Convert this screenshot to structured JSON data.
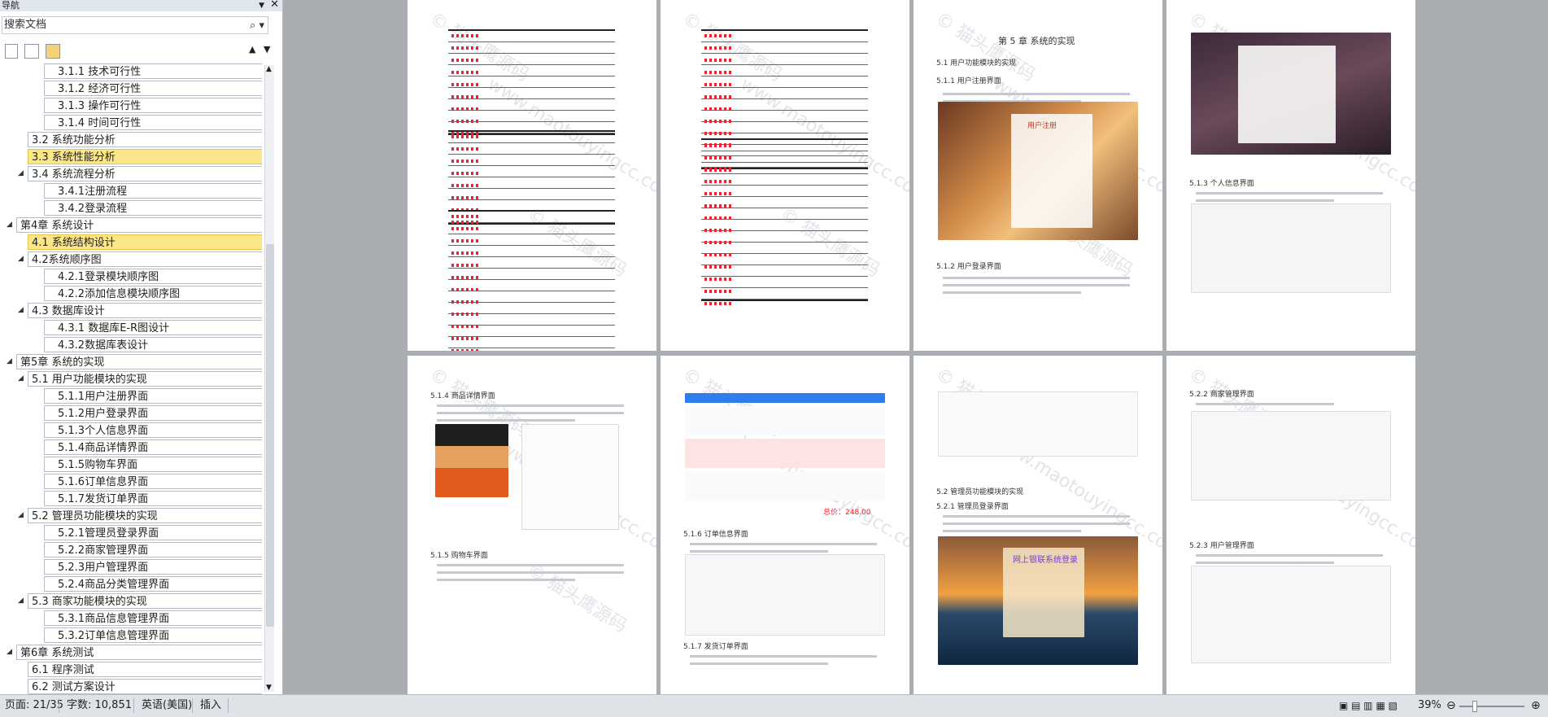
{
  "nav": {
    "title": "导航",
    "search_placeholder": "搜索文档",
    "items": [
      {
        "label": "3.1.1 技术可行性",
        "level": 2
      },
      {
        "label": "3.1.2 经济可行性",
        "level": 2
      },
      {
        "label": "3.1.3 操作可行性",
        "level": 2
      },
      {
        "label": "3.1.4 时间可行性",
        "level": 2
      },
      {
        "label": "3.2 系统功能分析",
        "level": 1
      },
      {
        "label": "3.3 系统性能分析",
        "level": 1,
        "selected": true
      },
      {
        "label": "3.4 系统流程分析",
        "level": 1,
        "toggle": true
      },
      {
        "label": "3.4.1注册流程",
        "level": 2
      },
      {
        "label": "3.4.2登录流程",
        "level": 2
      },
      {
        "label": "第4章  系统设计",
        "level": 0,
        "toggle": true
      },
      {
        "label": "4.1 系统结构设计",
        "level": 1,
        "selected": true
      },
      {
        "label": "4.2系统顺序图",
        "level": 1,
        "toggle": true
      },
      {
        "label": "4.2.1登录模块顺序图",
        "level": 2
      },
      {
        "label": "4.2.2添加信息模块顺序图",
        "level": 2
      },
      {
        "label": "4.3 数据库设计",
        "level": 1,
        "toggle": true
      },
      {
        "label": "4.3.1  数据库E-R图设计",
        "level": 2
      },
      {
        "label": "4.3.2数据库表设计",
        "level": 2
      },
      {
        "label": "第5章  系统的实现",
        "level": 0,
        "toggle": true
      },
      {
        "label": "5.1 用户功能模块的实现",
        "level": 1,
        "toggle": true
      },
      {
        "label": "5.1.1用户注册界面",
        "level": 2
      },
      {
        "label": "5.1.2用户登录界面",
        "level": 2
      },
      {
        "label": "5.1.3个人信息界面",
        "level": 2
      },
      {
        "label": "5.1.4商品详情界面",
        "level": 2
      },
      {
        "label": "5.1.5购物车界面",
        "level": 2
      },
      {
        "label": "5.1.6订单信息界面",
        "level": 2
      },
      {
        "label": "5.1.7发货订单界面",
        "level": 2
      },
      {
        "label": "5.2 管理员功能模块的实现",
        "level": 1,
        "toggle": true
      },
      {
        "label": "5.2.1管理员登录界面",
        "level": 2
      },
      {
        "label": "5.2.2商家管理界面",
        "level": 2
      },
      {
        "label": "5.2.3用户管理界面",
        "level": 2
      },
      {
        "label": "5.2.4商品分类管理界面",
        "level": 2
      },
      {
        "label": "5.3 商家功能模块的实现",
        "level": 1,
        "toggle": true
      },
      {
        "label": "5.3.1商品信息管理界面",
        "level": 2
      },
      {
        "label": "5.3.2订单信息管理界面",
        "level": 2
      },
      {
        "label": "第6章 系统测试",
        "level": 0,
        "toggle": true
      },
      {
        "label": "6.1 程序测试",
        "level": 1
      },
      {
        "label": "6.2 测试方案设计",
        "level": 1
      }
    ]
  },
  "pages": {
    "chapter5_title": "第 5 章   系统的实现",
    "p3_h1": "5.1 用户功能模块的实现",
    "p3_h2": "5.1.1 用户注册界面",
    "p3_h3": "5.1.2 用户登录界面",
    "p4_h1": "5.1.3 个人信息界面",
    "p5_h1": "5.1.4 商品详情界面",
    "p5_h2": "5.1.5 购物车界面",
    "p6_h1": "5.1.6 订单信息界面",
    "p6_h2": "5.1.7 发货订单界面",
    "p7_h1": "5.2 管理员功能模块的实现",
    "p7_h2": "5.2.1 管理员登录界面",
    "p7_login_title": "网上银联系统登录",
    "p8_h1": "5.2.2 商家管理界面",
    "p8_h2": "5.2.3 用户管理界面",
    "cart_total": "总价：248.00",
    "reg_title": "用户注册",
    "watermark_cn": "© 猫头鹰源码",
    "watermark_en": "www.maotouyingcc.com"
  },
  "status": {
    "page": "页面: 21/35",
    "words": "字数: 10,851",
    "lang": "英语(美国)",
    "mode": "插入",
    "zoom": "39%"
  }
}
